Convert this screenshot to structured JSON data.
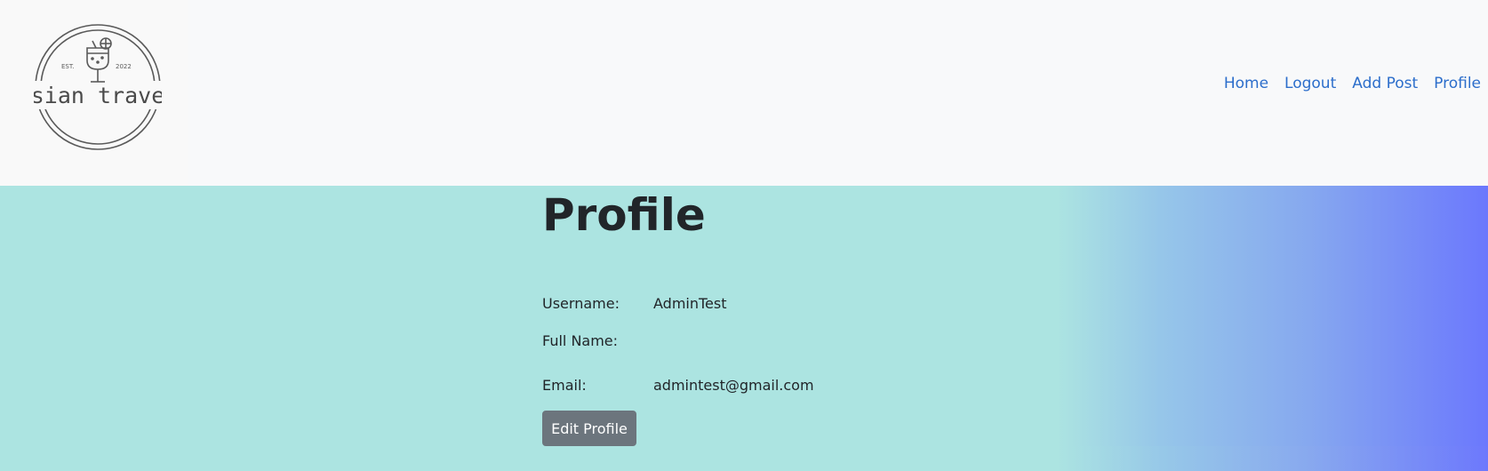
{
  "logo": {
    "est_text": "EST.",
    "year_text": "2022",
    "brand_text": "asian travel"
  },
  "nav": {
    "items": [
      {
        "label": "Home"
      },
      {
        "label": "Logout"
      },
      {
        "label": "Add Post"
      },
      {
        "label": "Profile"
      }
    ]
  },
  "profile": {
    "title": "Profile",
    "username_label": "Username:",
    "username_value": "AdminTest",
    "fullname_label": "Full Name:",
    "fullname_value": "",
    "email_label": "Email:",
    "email_value": "admintest@gmail.com",
    "edit_button_label": "Edit Profile"
  },
  "colors": {
    "nav_bg": "#f8f9fa",
    "link": "#2c6ecb",
    "main_bg_left": "#ace4e1",
    "main_bg_right": "#6b78fd",
    "button_bg": "#6c757d",
    "text": "#212529"
  }
}
